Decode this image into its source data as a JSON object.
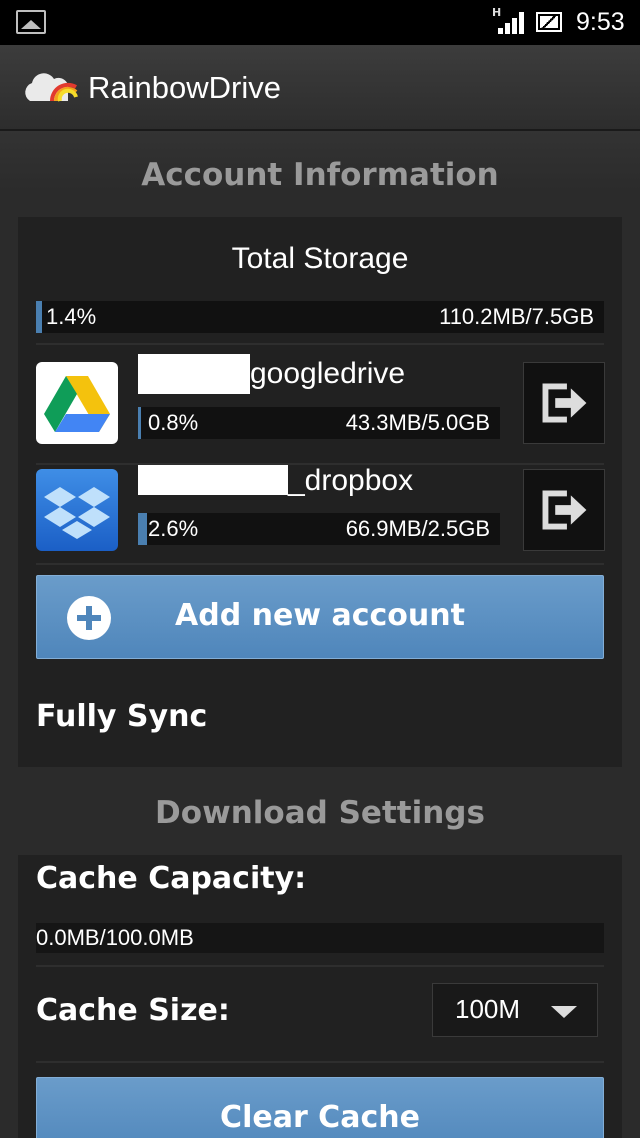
{
  "status_bar": {
    "time": "9:53",
    "network": "H"
  },
  "app": {
    "title": "RainbowDrive"
  },
  "account_section": {
    "title": "Account Information",
    "total_storage": {
      "label": "Total Storage",
      "percent": "1.4%",
      "amount": "110.2MB/7.5GB",
      "fill_fraction": 0.014
    },
    "accounts": [
      {
        "name": "googledrive",
        "percent": "0.8%",
        "amount": "43.3MB/5.0GB",
        "fill_fraction": 0.008,
        "icon": "google-drive-icon"
      },
      {
        "name": "_dropbox",
        "percent": "2.6%",
        "amount": "66.9MB/2.5GB",
        "fill_fraction": 0.026,
        "icon": "dropbox-icon"
      }
    ],
    "add_button_label": "Add new account",
    "fully_sync_label": "Fully Sync"
  },
  "download_section": {
    "title": "Download Settings",
    "cache_capacity_label": "Cache Capacity:",
    "cache_capacity_value": "0.0MB/100.0MB",
    "cache_size_label": "Cache Size:",
    "cache_size_value": "100M",
    "clear_cache_label": "Clear Cache"
  },
  "colors": {
    "accent": "#4f86bb",
    "background": "#2b2b2b",
    "panel": "#212121"
  }
}
